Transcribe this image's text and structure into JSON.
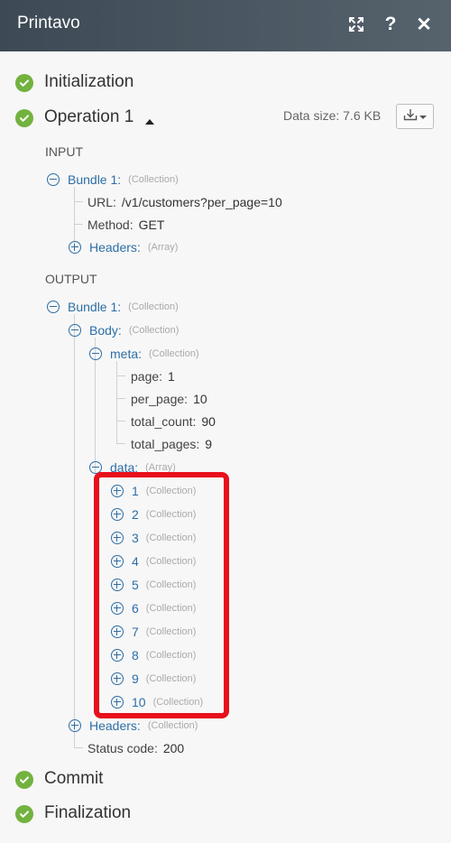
{
  "header": {
    "title": "Printavo"
  },
  "steps": {
    "initialization": "Initialization",
    "operation": "Operation 1",
    "commit": "Commit",
    "finalization": "Finalization"
  },
  "data_size": "Data size: 7.6 KB",
  "input": {
    "caption": "INPUT",
    "bundle": {
      "key": "Bundle 1:",
      "type": "(Collection)"
    },
    "url": {
      "key": "URL:",
      "value": "/v1/customers?per_page=10"
    },
    "method": {
      "key": "Method:",
      "value": "GET"
    },
    "headers": {
      "key": "Headers:",
      "type": "(Array)"
    }
  },
  "output": {
    "caption": "OUTPUT",
    "bundle": {
      "key": "Bundle 1:",
      "type": "(Collection)"
    },
    "body": {
      "key": "Body:",
      "type": "(Collection)"
    },
    "meta": {
      "key": "meta:",
      "type": "(Collection)"
    },
    "meta_fields": [
      {
        "key": "page:",
        "value": "1"
      },
      {
        "key": "per_page:",
        "value": "10"
      },
      {
        "key": "total_count:",
        "value": "90"
      },
      {
        "key": "total_pages:",
        "value": "9"
      }
    ],
    "data": {
      "key": "data:",
      "type": "(Array)"
    },
    "data_items": [
      {
        "key": "1",
        "type": "(Collection)"
      },
      {
        "key": "2",
        "type": "(Collection)"
      },
      {
        "key": "3",
        "type": "(Collection)"
      },
      {
        "key": "4",
        "type": "(Collection)"
      },
      {
        "key": "5",
        "type": "(Collection)"
      },
      {
        "key": "6",
        "type": "(Collection)"
      },
      {
        "key": "7",
        "type": "(Collection)"
      },
      {
        "key": "8",
        "type": "(Collection)"
      },
      {
        "key": "9",
        "type": "(Collection)"
      },
      {
        "key": "10",
        "type": "(Collection)"
      }
    ],
    "headers": {
      "key": "Headers:",
      "type": "(Collection)"
    },
    "status": {
      "key": "Status code:",
      "value": "200"
    }
  },
  "colors": {
    "header_bg": "#3d4a55",
    "success": "#73b23f",
    "link": "#2d6ea6",
    "highlight": "#e8101c"
  },
  "icons": [
    "expand-icon",
    "help-icon",
    "close-icon",
    "check-icon",
    "caret-up-icon",
    "download-icon",
    "plus-circle-icon",
    "minus-circle-icon"
  ]
}
